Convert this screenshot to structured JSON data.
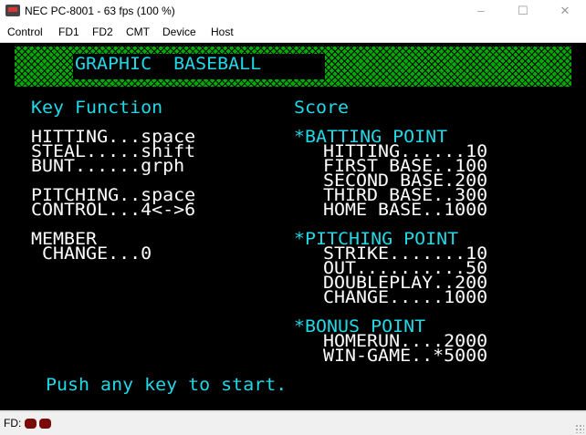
{
  "window": {
    "title": "NEC PC-8001 - 63 fps (100 %)",
    "controls": [
      "–",
      "☐",
      "✕"
    ]
  },
  "menu": [
    "Control",
    "FD1",
    "FD2",
    "CMT",
    "Device",
    "Host"
  ],
  "screen": {
    "title": "GRAPHIC  BASEBALL",
    "key_function": {
      "heading": "Key Function",
      "lines": [
        "HITTING...space",
        "STEAL.....shift",
        "BUNT......grph",
        "PITCHING..space",
        "CONTROL...4<->6",
        "MEMBER",
        " CHANGE...0"
      ]
    },
    "score": {
      "heading": "Score",
      "batting": {
        "heading": "*BATTING POINT",
        "lines": [
          "HITTING......10",
          "FIRST BASE..100",
          "SECOND BASE.200",
          "THIRD BASE..300",
          "HOME BASE..1000"
        ]
      },
      "pitching": {
        "heading": "*PITCHING POINT",
        "lines": [
          "STRIKE.......10",
          "OUT..........50",
          "DOUBLEPLAY..200",
          "CHANGE.....1000"
        ]
      },
      "bonus": {
        "heading": "*BONUS POINT",
        "lines": [
          "HOMERUN....2000",
          "WIN-GAME..*5000"
        ]
      }
    },
    "prompt": "Push any key to start."
  },
  "status": {
    "fd_label": "FD:",
    "led_color": "#7a0a0a"
  },
  "colors": {
    "white_text": "#ffffff",
    "cyan_text": "#1fd9e6",
    "banner_green": "#00aa00"
  }
}
